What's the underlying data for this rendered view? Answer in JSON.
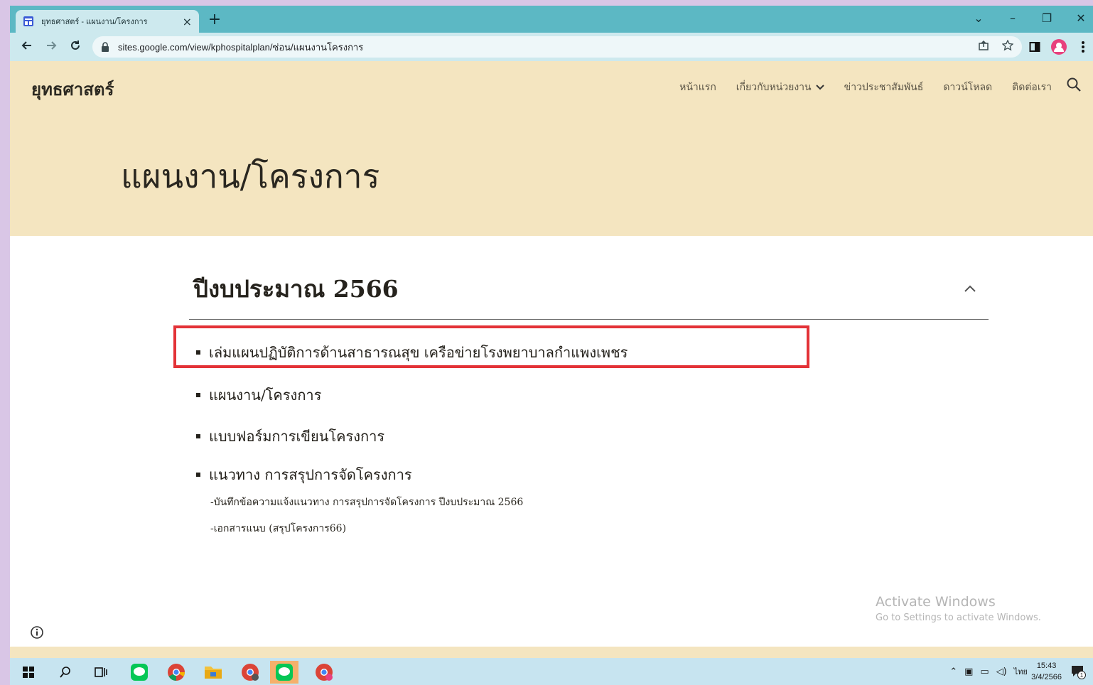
{
  "browser": {
    "tab_title": "ยุทธศาสตร์ - แผนงาน/โครงการ",
    "tab_close": "×",
    "new_tab": "+",
    "url": "sites.google.com/view/kphospitalplan/ซ่อน/แผนงานโครงการ",
    "window_controls": {
      "tab_search": "⌄",
      "minimize": "–",
      "restore": "❐",
      "close": "✕"
    }
  },
  "site": {
    "logo": "ยุทธศาสตร์",
    "nav": [
      {
        "label": "หน้าแรก"
      },
      {
        "label": "เกี่ยวกับหน่วยงาน"
      },
      {
        "label": "ข่าวประชาสัมพันธ์"
      },
      {
        "label": "ดาวน์โหลด"
      },
      {
        "label": "ติดต่อเรา"
      }
    ],
    "page_title": "แผนงาน/โครงการ",
    "section": {
      "heading": "ปีงบประมาณ 2566",
      "items": [
        {
          "label": "เล่มแผนปฏิบัติการด้านสาธารณสุข เครือข่ายโรงพยาบาลกำแพงเพชร",
          "highlighted": true
        },
        {
          "label": "แผนงาน/โครงการ"
        },
        {
          "label": "แบบฟอร์มการเขียนโครงการ"
        },
        {
          "label": "แนวทาง การสรุปการจัดโครงการ"
        }
      ],
      "sub_items": [
        "-บันทึกข้อความแจ้งแนวทาง การสรุปการจัดโครงการ ปีงบประมาณ 2566",
        "-เอกสารแนบ (สรุปโครงการ66)"
      ]
    },
    "highlight_color": "#e33237",
    "header_bg": "#f4e5c0"
  },
  "watermark": {
    "line1": "Activate Windows",
    "line2": "Go to Settings to activate Windows."
  },
  "taskbar": {
    "lang": "ไทย",
    "time": "15:43",
    "date": "3/4/2566",
    "notification_count": "1"
  }
}
